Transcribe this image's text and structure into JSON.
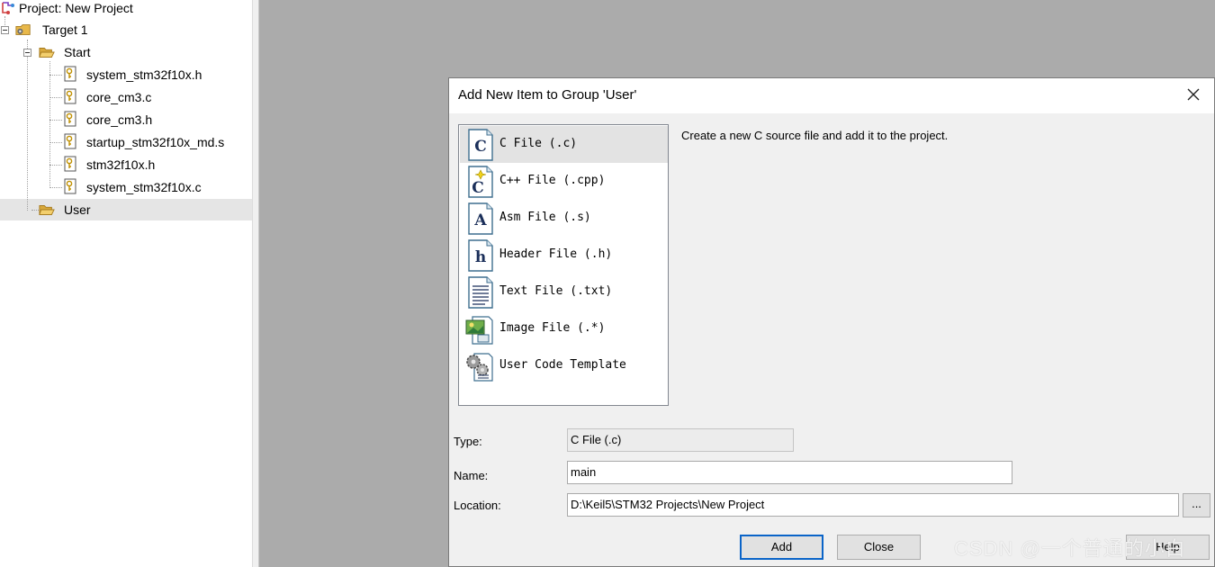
{
  "project_tree": {
    "project_label": "Project: New Project",
    "target_label": "Target 1",
    "groups": [
      {
        "label": "Start",
        "files": [
          "system_stm32f10x.h",
          "core_cm3.c",
          "core_cm3.h",
          "startup_stm32f10x_md.s",
          "stm32f10x.h",
          "system_stm32f10x.c"
        ]
      },
      {
        "label": "User",
        "files": []
      }
    ]
  },
  "dialog": {
    "title": "Add New Item to Group 'User'",
    "items": [
      {
        "label": "C File (.c)",
        "icon": "c-file-icon",
        "glyph": "C"
      },
      {
        "label": "C++ File (.cpp)",
        "icon": "cpp-file-icon",
        "glyph": "C"
      },
      {
        "label": "Asm File (.s)",
        "icon": "asm-file-icon",
        "glyph": "A"
      },
      {
        "label": "Header File (.h)",
        "icon": "header-file-icon",
        "glyph": "h"
      },
      {
        "label": "Text File (.txt)",
        "icon": "text-file-icon"
      },
      {
        "label": "Image File (.*)",
        "icon": "image-file-icon"
      },
      {
        "label": "User Code Template",
        "icon": "gears-icon"
      }
    ],
    "description": "Create a new C source file and add it to the project.",
    "type_label": "Type:",
    "type_value": "C File (.c)",
    "name_label": "Name:",
    "name_value": "main",
    "location_label": "Location:",
    "location_value": "D:\\Keil5\\STM32 Projects\\New Project",
    "browse_label": "...",
    "add_label": "Add",
    "close_label": "Close",
    "help_label": "Help"
  },
  "watermark": "CSDN @一个普通的小白",
  "colors": {
    "desktop": "#ababab",
    "dialog_bg": "#f0f0f0",
    "selection": "#e3e3e3",
    "default_button_border": "#0a64c8"
  }
}
